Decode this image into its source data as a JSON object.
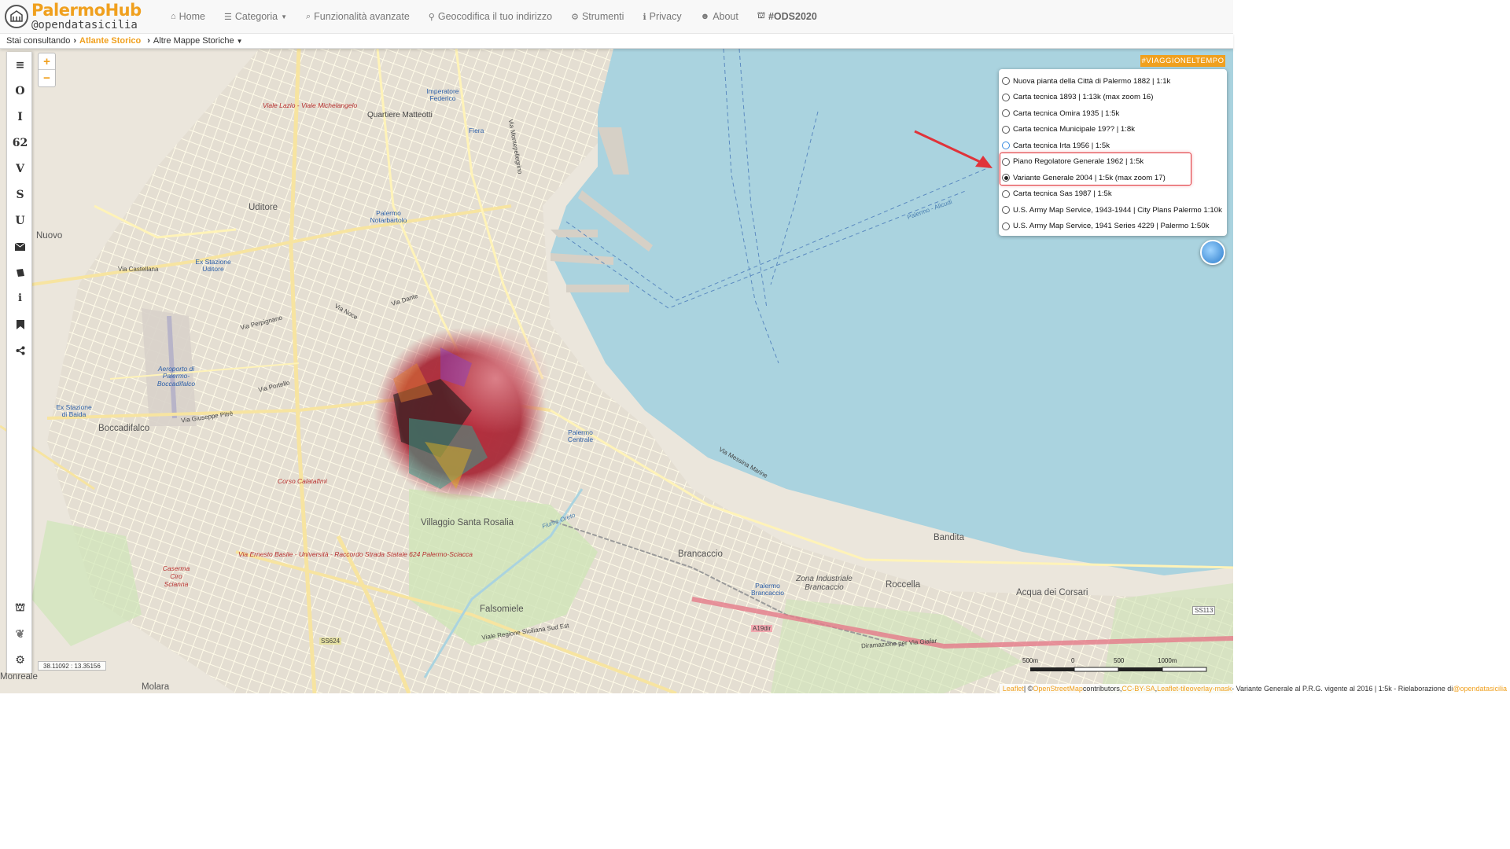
{
  "brand": {
    "name": "PalermoHub",
    "handle": "@opendatasicilia"
  },
  "nav": [
    {
      "icon": "home-icon",
      "glyph": "⌂",
      "label": "Home"
    },
    {
      "icon": "list-icon",
      "glyph": "☰",
      "label": "Categoria",
      "caret": true
    },
    {
      "icon": "search-icon",
      "glyph": "⌕",
      "label": "Funzionalità avanzate"
    },
    {
      "icon": "map-marker-icon",
      "glyph": "⚲",
      "label": "Geocodifica il tuo indirizzo"
    },
    {
      "icon": "gear-icon",
      "glyph": "⚙",
      "label": "Strumenti"
    },
    {
      "icon": "info-icon",
      "glyph": "ℹ",
      "label": "Privacy"
    },
    {
      "icon": "users-icon",
      "glyph": "👥",
      "label": "About"
    },
    {
      "icon": "ods-logo-icon",
      "glyph": "⛫",
      "label": "#ODS2020"
    }
  ],
  "breadcrumb": {
    "prefix": "Stai consultando",
    "active": "Atlante Storico",
    "next": "Altre Mappe Storiche"
  },
  "sidebar": {
    "letters": [
      "O",
      "I",
      "62",
      "V",
      "S",
      "U"
    ]
  },
  "zoom": {
    "in": "+",
    "out": "−"
  },
  "hashtag": "#VIAGGIONELTEMPO",
  "layers": [
    {
      "label": "Nuova pianta della Città di Palermo 1882 | 1:1k",
      "checked": false
    },
    {
      "label": "Carta tecnica 1893 | 1:13k (max zoom 16)",
      "checked": false
    },
    {
      "label": "Carta tecnica Omira 1935 | 1:5k",
      "checked": false
    },
    {
      "label": "Carta tecnica Municipale 19?? | 1:8k",
      "checked": false
    },
    {
      "label": "Carta tecnica Irta 1956 | 1:5k",
      "checked": false
    },
    {
      "label": "Piano Regolatore Generale 1962 | 1:5k",
      "checked": false
    },
    {
      "label": "Variante Generale 2004 | 1:5k (max zoom 17)",
      "checked": true
    },
    {
      "label": "Carta tecnica Sas 1987 | 1:5k",
      "checked": false
    },
    {
      "label": "U.S. Army Map Service, 1943-1944 | City Plans Palermo 1:10k",
      "checked": false
    },
    {
      "label": "U.S. Army Map Service, 1941 Series 4229 | Palermo 1:50k",
      "checked": false
    }
  ],
  "coords": "38.11092 : 13.35156",
  "scale": {
    "l0": "500m",
    "l1": "0",
    "l2": "500",
    "l3": "1000m"
  },
  "attribution": {
    "leaflet": "Leaflet",
    "osm_prefix": " | ©",
    "osm": "OpenStreetMap",
    "contrib": " contributors, ",
    "license": "CC-BY-SA",
    "sep": ", ",
    "plugin": "Leaflet-tileoverlay-mask",
    "desc": " - Variante Generale al P.R.G. vigente al 2016 | 1:5k - Rielaborazione di ",
    "author": "@opendatasicilia"
  },
  "map_labels": [
    {
      "text": "Uditore",
      "style": "big"
    },
    {
      "text": "Nuovo",
      "style": "big"
    },
    {
      "text": "Boccadifalco",
      "style": "big"
    },
    {
      "text": "Villaggio Santa Rosalia",
      "style": "big"
    },
    {
      "text": "Brancaccio",
      "style": "big"
    },
    {
      "text": "Falsomiele",
      "style": "big"
    },
    {
      "text": "Roccella",
      "style": "big"
    },
    {
      "text": "Bandita",
      "style": "big"
    },
    {
      "text": "Acqua dei Corsari",
      "style": "big"
    },
    {
      "text": "Molara",
      "style": "big"
    },
    {
      "text": "Monreale",
      "style": "big"
    },
    {
      "text": "Quartiere Matteotti",
      "style": ""
    },
    {
      "text": "Imperatore Federico",
      "style": "blue"
    },
    {
      "text": "Fiera",
      "style": "blue"
    },
    {
      "text": "Palermo Notarbartolo",
      "style": "blue"
    },
    {
      "text": "Ex Stazione Uditore",
      "style": "blue"
    },
    {
      "text": "Aeroporto di Palermo-Boccadifalco",
      "style": "blue"
    },
    {
      "text": "Ex Stazione di Baida",
      "style": "blue"
    },
    {
      "text": "Palermo Centrale",
      "style": "blue"
    },
    {
      "text": "Palermo Brancaccio",
      "style": "blue"
    },
    {
      "text": "Viale Lazio - Viale Michelangelo",
      "style": "red"
    },
    {
      "text": "Corso Calatafimi",
      "style": "red"
    },
    {
      "text": "Caserma Ciro Scianna",
      "style": "red"
    },
    {
      "text": "Via Ernesto Basile - Università - Raccordo Strada Statale 624 Palermo-Sciacca",
      "style": "red"
    },
    {
      "text": "Zona Industriale Brancaccio",
      "style": ""
    },
    {
      "text": "Via Castellana",
      "style": ""
    },
    {
      "text": "Via Dante",
      "style": ""
    },
    {
      "text": "Via Giuseppe Pitrè",
      "style": ""
    },
    {
      "text": "Via Perpignano",
      "style": ""
    },
    {
      "text": "Via Noce",
      "style": ""
    },
    {
      "text": "Via Messina Marine",
      "style": ""
    },
    {
      "text": "Via Montepellegrino",
      "style": ""
    },
    {
      "text": "Via Portello",
      "style": ""
    },
    {
      "text": "Viale Regione Siciliana Sud Est",
      "style": ""
    },
    {
      "text": "Diramazione per Via Giafar",
      "style": ""
    },
    {
      "text": "Fiume Oreto",
      "style": ""
    },
    {
      "text": "Palermo - Alicudi",
      "style": ""
    },
    {
      "text": "SS624",
      "style": ""
    },
    {
      "text": "A19dir",
      "style": ""
    },
    {
      "text": "SS113",
      "style": ""
    }
  ],
  "colors": {
    "accent": "#f0a01e",
    "sea": "#aad3df",
    "land": "#ede9e0",
    "highlight": "#e0333a"
  }
}
